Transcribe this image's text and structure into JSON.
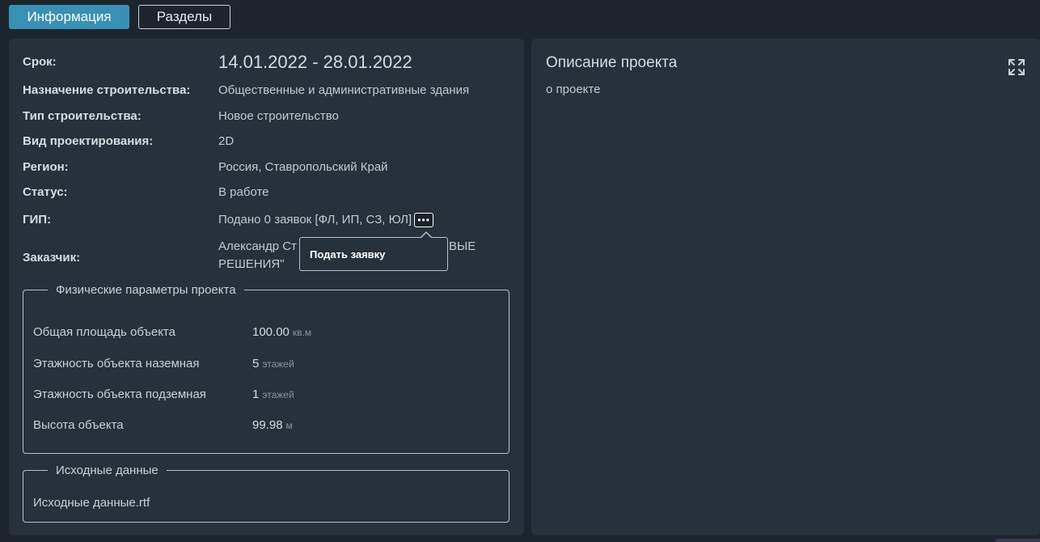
{
  "tabs": {
    "info": "Информация",
    "sections": "Разделы"
  },
  "info": {
    "term": {
      "label": "Срок:",
      "value": "14.01.2022 - 28.01.2022"
    },
    "purpose": {
      "label": "Назначение строительства:",
      "value": "Общественные и административные здания"
    },
    "type": {
      "label": "Тип строительства:",
      "value": "Новое строительство"
    },
    "design": {
      "label": "Вид проектирования:",
      "value": "2D"
    },
    "region": {
      "label": "Регион:",
      "value": "Россия, Ставропольский Край"
    },
    "status": {
      "label": "Статус:",
      "value": "В работе"
    },
    "gip": {
      "label": "ГИП:",
      "value": "Подано 0 заявок [ФЛ, ИП, СЗ, ЮЛ]"
    },
    "customer": {
      "label": "Заказчик:",
      "value_line1_start": "Александр Ст",
      "value_line1_end": "ВЫЕ",
      "value_line2": "РЕШЕНИЯ\""
    }
  },
  "popup": {
    "item": "Подать заявку"
  },
  "physical": {
    "legend": "Физические параметры проекта",
    "params": [
      {
        "label": "Общая площадь объекта",
        "value": "100.00",
        "unit": "кв.м"
      },
      {
        "label": "Этажность объекта наземная",
        "value": "5",
        "unit": "этажей"
      },
      {
        "label": "Этажность объекта подземная",
        "value": "1",
        "unit": "этажей"
      },
      {
        "label": "Высота объекта",
        "value": "99.98",
        "unit": "м"
      }
    ]
  },
  "source": {
    "legend": "Исходные данные",
    "file": "Исходные данные.rtf"
  },
  "description": {
    "title": "Описание проекта",
    "text": "о проекте"
  },
  "icons": {
    "more": "more-dots-icon",
    "expand": "expand-icon"
  },
  "colors": {
    "accent": "#3a8fb5",
    "panel": "#26313b",
    "background": "#1c252d"
  }
}
